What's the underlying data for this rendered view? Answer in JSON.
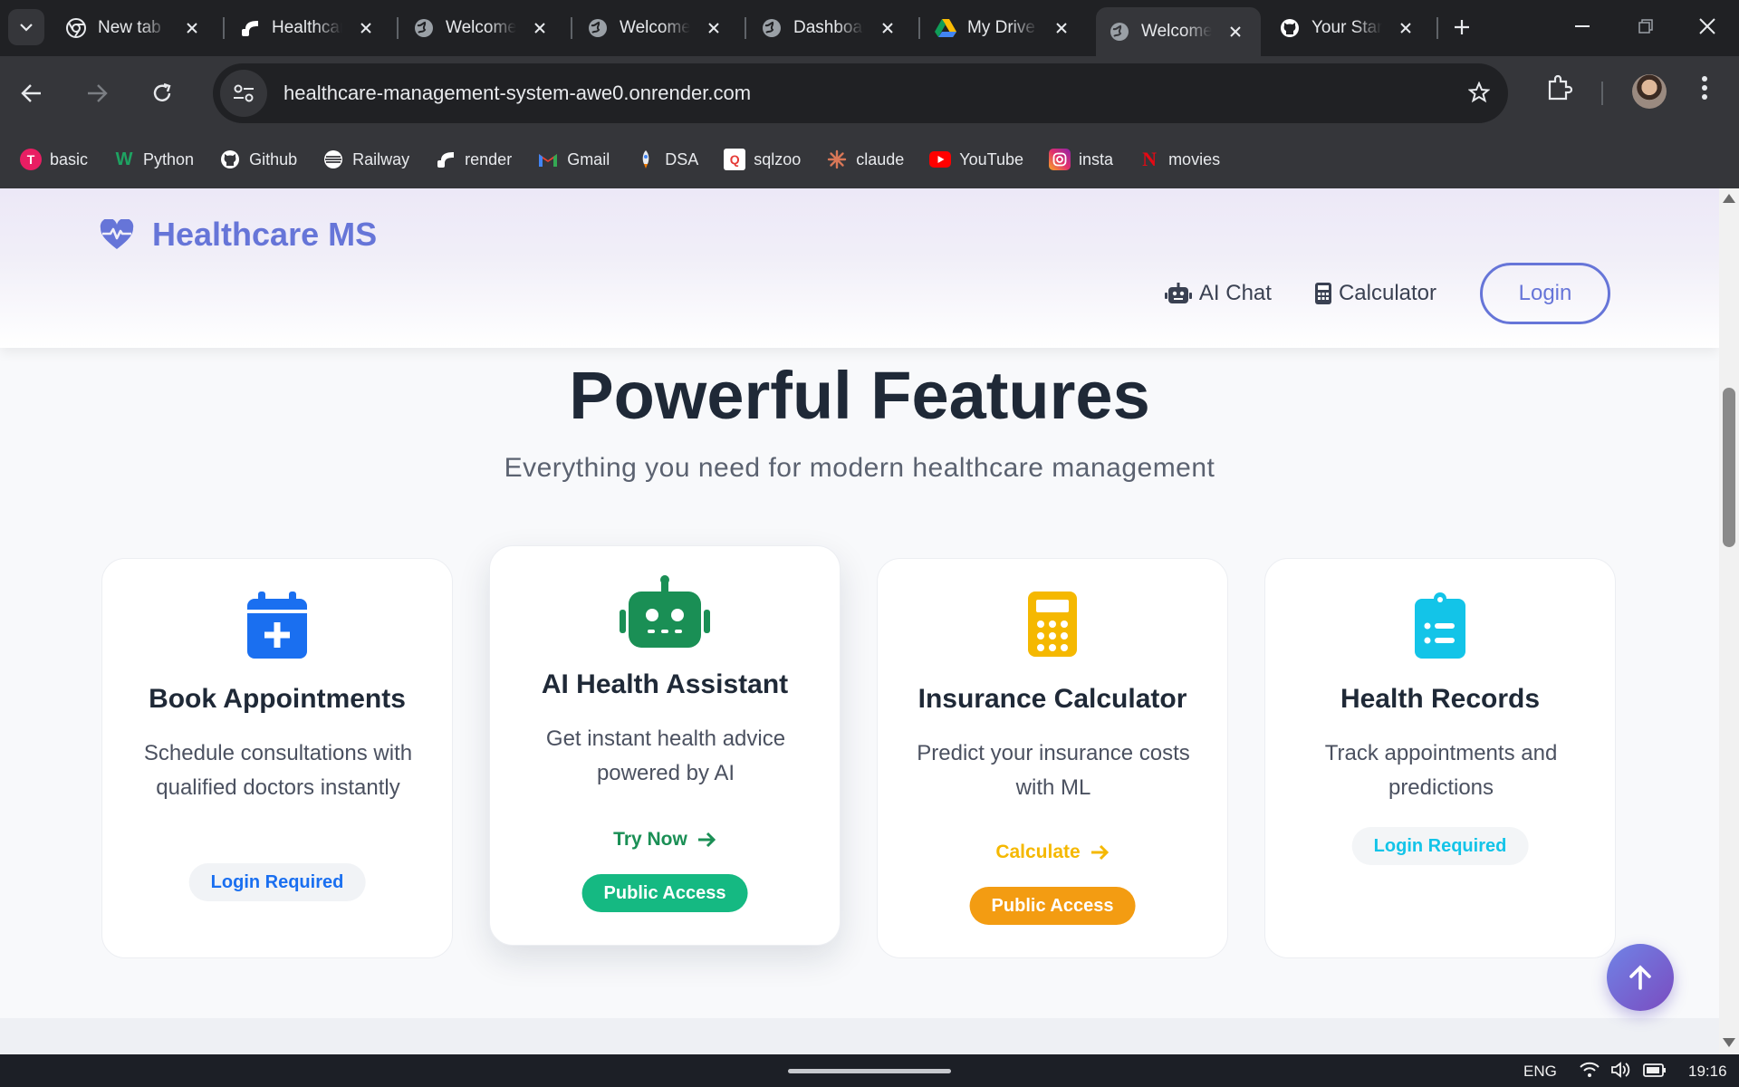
{
  "browser": {
    "tabs": [
      {
        "title": "New tab",
        "icon": "chrome-icon",
        "active": false
      },
      {
        "title": "Healthcare",
        "icon": "render-icon",
        "active": false
      },
      {
        "title": "Welcome",
        "icon": "globe-icon",
        "active": false
      },
      {
        "title": "Welcome",
        "icon": "globe-icon",
        "active": false
      },
      {
        "title": "Dashboard",
        "icon": "globe-icon",
        "active": false
      },
      {
        "title": "My Drive",
        "icon": "google-drive-icon",
        "active": false
      },
      {
        "title": "Welcome",
        "icon": "globe-icon",
        "active": true
      },
      {
        "title": "Your Stars",
        "icon": "github-icon",
        "active": false
      }
    ],
    "url": "healthcare-management-system-awe0.onrender.com",
    "bookmarks": [
      {
        "label": "basic",
        "icon": "basic-icon",
        "color": "#e91e63"
      },
      {
        "label": "Python",
        "icon": "python-icon",
        "color": "#1ea362"
      },
      {
        "label": "Github",
        "icon": "github-icon",
        "color": "#ffffff"
      },
      {
        "label": "Railway",
        "icon": "railway-icon",
        "color": "#ffffff"
      },
      {
        "label": "render",
        "icon": "render-icon",
        "color": "#ffffff"
      },
      {
        "label": "Gmail",
        "icon": "gmail-icon",
        "color": "#ea4335"
      },
      {
        "label": "DSA",
        "icon": "rocket-icon",
        "color": "#8ab4f8"
      },
      {
        "label": "sqlzoo",
        "icon": "sqlzoo-icon",
        "color": "#e53935"
      },
      {
        "label": "claude",
        "icon": "claude-icon",
        "color": "#d97757"
      },
      {
        "label": "YouTube",
        "icon": "youtube-icon",
        "color": "#ff0000"
      },
      {
        "label": "insta",
        "icon": "instagram-icon",
        "color": "#e1306c"
      },
      {
        "label": "movies",
        "icon": "netflix-icon",
        "color": "#e50914"
      }
    ]
  },
  "site": {
    "brand": "Healthcare MS",
    "brand_color": "#6675d8",
    "nav": {
      "ai_chat": "AI Chat",
      "calculator": "Calculator",
      "login": "Login"
    }
  },
  "features": {
    "title": "Powerful Features",
    "subtitle": "Everything you need for modern healthcare management",
    "cards": [
      {
        "icon": "calendar-plus-icon",
        "title": "Book Appointments",
        "description": "Schedule consultations with qualified doctors instantly",
        "link": "",
        "badge": "Login Required",
        "accent": "#1a6ff0"
      },
      {
        "icon": "robot-icon",
        "title": "AI Health Assistant",
        "description": "Get instant health advice powered by AI",
        "link": "Try Now",
        "badge": "Public Access",
        "accent": "#1a8f55"
      },
      {
        "icon": "calculator-icon",
        "title": "Insurance Calculator",
        "description": "Predict your insurance costs with ML",
        "link": "Calculate",
        "badge": "Public Access",
        "accent": "#f5b800"
      },
      {
        "icon": "clipboard-list-icon",
        "title": "Health Records",
        "description": "Track appointments and predictions",
        "link": "",
        "badge": "Login Required",
        "accent": "#13c4e8"
      }
    ]
  },
  "taskbar": {
    "language": "ENG",
    "time": "19:16"
  }
}
